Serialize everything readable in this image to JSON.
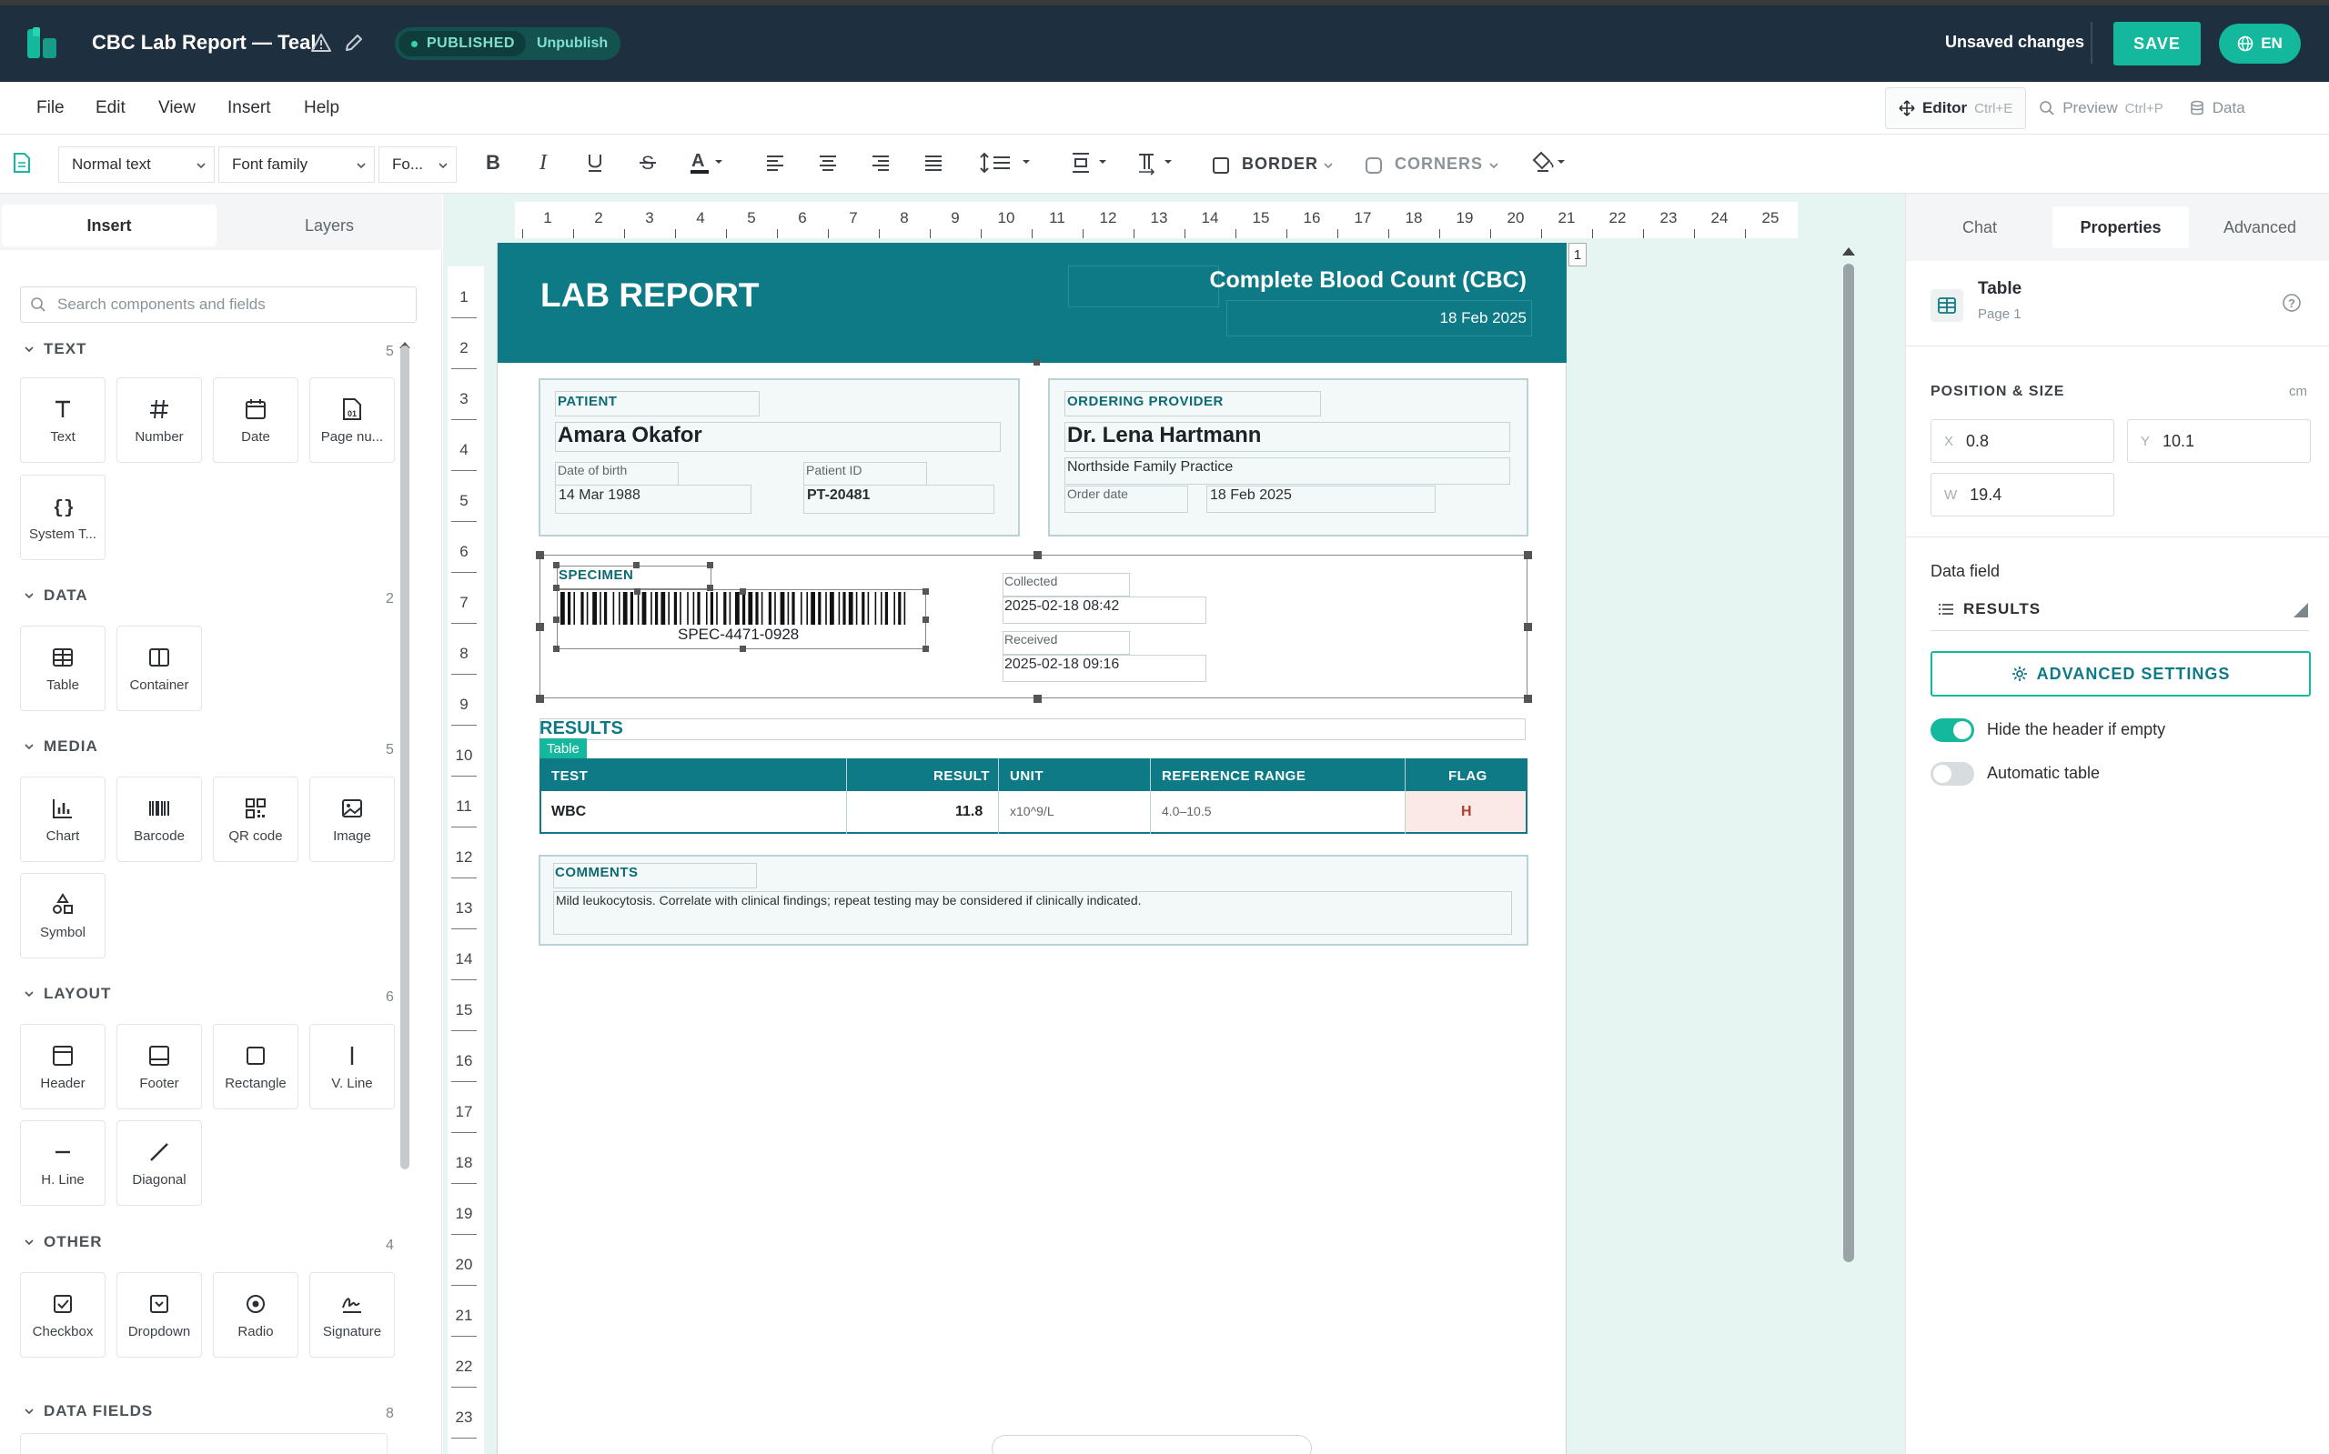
{
  "topbar": {
    "title": "CBC Lab Report — Teal",
    "status": "PUBLISHED",
    "unpublish": "Unpublish",
    "unsaved": "Unsaved changes",
    "save": "SAVE",
    "lang": "EN"
  },
  "menu": {
    "file": "File",
    "edit": "Edit",
    "view": "View",
    "insert": "Insert",
    "help": "Help"
  },
  "modes": {
    "editor": "Editor",
    "editor_kbd": "Ctrl+E",
    "preview": "Preview",
    "preview_kbd": "Ctrl+P",
    "data": "Data"
  },
  "toolbar": {
    "style": "Normal text",
    "font_family": "Font family",
    "font_size": "Fo...",
    "border": "BORDER",
    "corners": "CORNERS"
  },
  "left": {
    "tab_insert": "Insert",
    "tab_layers": "Layers",
    "search_placeholder": "Search components and fields",
    "sections": [
      {
        "title": "TEXT",
        "count": "5",
        "items": [
          "Text",
          "Number",
          "Date",
          "Page nu...",
          "System T..."
        ]
      },
      {
        "title": "DATA",
        "count": "2",
        "items": [
          "Table",
          "Container"
        ]
      },
      {
        "title": "MEDIA",
        "count": "5",
        "items": [
          "Chart",
          "Barcode",
          "QR code",
          "Image",
          "Symbol"
        ]
      },
      {
        "title": "LAYOUT",
        "count": "6",
        "items": [
          "Header",
          "Footer",
          "Rectangle",
          "V. Line",
          "H. Line",
          "Diagonal"
        ]
      },
      {
        "title": "OTHER",
        "count": "4",
        "items": [
          "Checkbox",
          "Dropdown",
          "Radio",
          "Signature"
        ]
      },
      {
        "title": "DATA FIELDS",
        "count": "8",
        "items": []
      }
    ]
  },
  "ruler": {
    "h": [
      "1",
      "2",
      "3",
      "4",
      "5",
      "6",
      "7",
      "8",
      "9",
      "10",
      "11",
      "12",
      "13",
      "14",
      "15",
      "16",
      "17",
      "18",
      "19",
      "20",
      "21",
      "22",
      "23",
      "24",
      "25"
    ],
    "v": [
      "1",
      "2",
      "3",
      "4",
      "5",
      "6",
      "7",
      "8",
      "9",
      "10",
      "11",
      "12",
      "13",
      "14",
      "15",
      "16",
      "17",
      "18",
      "19",
      "20",
      "21",
      "22",
      "23"
    ],
    "page": "1"
  },
  "doc": {
    "title": "LAB REPORT",
    "subtitle": "Complete Blood Count (CBC)",
    "date": "18 Feb 2025",
    "patient": {
      "label": "PATIENT",
      "name": "Amara Okafor",
      "dob_label": "Date of birth",
      "dob": "14 Mar 1988",
      "id_label": "Patient ID",
      "id": "PT-20481"
    },
    "provider": {
      "label": "ORDERING PROVIDER",
      "name": "Dr. Lena Hartmann",
      "practice": "Northside Family Practice",
      "order_label": "Order date",
      "order_date": "18 Feb 2025"
    },
    "specimen": {
      "label": "SPECIMEN",
      "barcode": "SPEC-4471-0928",
      "collected_label": "Collected",
      "collected": "2025-02-18 08:42",
      "received_label": "Received",
      "received": "2025-02-18 09:16"
    },
    "results": {
      "label": "RESULTS",
      "badge": "Table",
      "columns": [
        "TEST",
        "RESULT",
        "UNIT",
        "REFERENCE RANGE",
        "FLAG"
      ],
      "row": {
        "test": "WBC",
        "result": "11.8",
        "unit": "x10^9/L",
        "range": "4.0–10.5",
        "flag": "H"
      }
    },
    "comments": {
      "label": "COMMENTS",
      "text": "Mild leukocytosis. Correlate with clinical findings; repeat testing may be considered if clinically indicated."
    }
  },
  "right": {
    "tab_chat": "Chat",
    "tab_properties": "Properties",
    "tab_advanced": "Advanced",
    "type": "Table",
    "page": "Page 1",
    "pos_heading": "POSITION & SIZE",
    "unit": "cm",
    "x_label": "X",
    "x": "0.8",
    "y_label": "Y",
    "y": "10.1",
    "w_label": "W",
    "w": "19.4",
    "data_field_label": "Data field",
    "data_field": "RESULTS",
    "advanced_btn": "ADVANCED SETTINGS",
    "toggle_hide_header": "Hide the header if empty",
    "hide_header_on": true,
    "toggle_auto": "Automatic table",
    "auto_on": false
  },
  "colors": {
    "brand": "#14b89c",
    "header_teal": "#0e7a86",
    "topbar": "#1e2f3f",
    "flag_bg": "#fbe9e7",
    "flag_text": "#b3402a"
  }
}
